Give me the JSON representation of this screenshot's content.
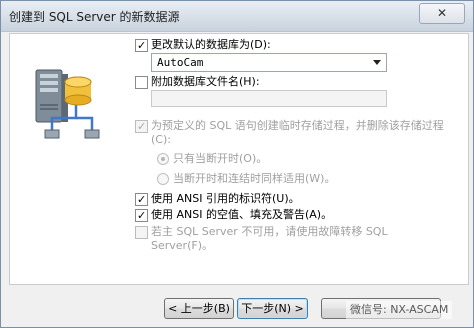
{
  "window": {
    "title": "创建到 SQL Server 的新数据源",
    "close_label": "✕"
  },
  "options": {
    "change_default_db": {
      "label": "更改默认的数据库为(D):",
      "checked": true
    },
    "default_db_value": "AutoCam",
    "attach_db_file": {
      "label": "附加数据库文件名(H):",
      "checked": false
    },
    "attach_db_value": "",
    "create_temp_proc": {
      "label_line1": "为预定义的 SQL 语句创建临时存储过程，并删除该存储过程",
      "label_line2": "(C):",
      "checked": true
    },
    "radio_only_disconnect": {
      "label": "只有当断开时(O)。",
      "selected": true
    },
    "radio_disconnect_and_connect": {
      "label": "当断开时和连结时同样适用(W)。",
      "selected": false
    },
    "ansi_quoted": {
      "label": "使用 ANSI 引用的标识符(U)。",
      "checked": true
    },
    "ansi_nulls": {
      "label": "使用 ANSI 的空值、填充及警告(A)。",
      "checked": true
    },
    "failover": {
      "label_line1": "若主 SQL Server 不可用，请使用故障转移 SQL",
      "label_line2": "Server(F)。",
      "checked": false
    }
  },
  "buttons": {
    "back": "< 上一步(B)",
    "next": "下一步(N) >",
    "cancel_partial": "取消"
  },
  "watermark": "微信号: NX-ASCAM"
}
